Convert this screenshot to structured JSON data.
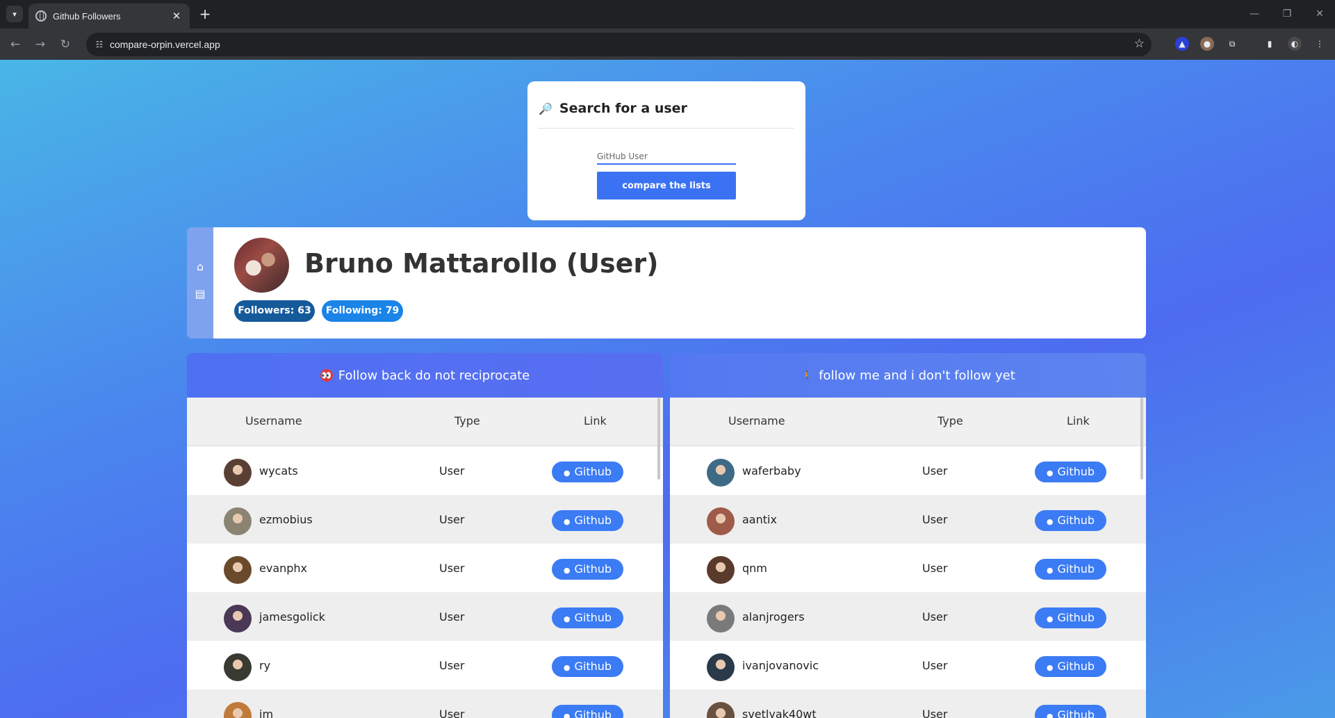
{
  "browser": {
    "tab_title": "Github Followers",
    "url": "compare-orpin.vercel.app"
  },
  "search": {
    "title": "Search for a user",
    "placeholder": "GitHub User",
    "button_label": "compare the lists"
  },
  "profile": {
    "name": "Bruno Mattarollo (User)",
    "followers_label": "Followers: 63",
    "following_label": "Following: 79"
  },
  "columns": {
    "username": "Username",
    "type": "Type",
    "link": "Link"
  },
  "left_panel": {
    "title": "Follow back do not reciprocate",
    "rows": [
      {
        "username": "wycats",
        "type": "User",
        "link": "Github",
        "avatar_color": "#5a4034"
      },
      {
        "username": "ezmobius",
        "type": "User",
        "link": "Github",
        "avatar_color": "#8b8472"
      },
      {
        "username": "evanphx",
        "type": "User",
        "link": "Github",
        "avatar_color": "#6a4a2a"
      },
      {
        "username": "jamesgolick",
        "type": "User",
        "link": "Github",
        "avatar_color": "#4a3856"
      },
      {
        "username": "ry",
        "type": "User",
        "link": "Github",
        "avatar_color": "#3a3a32"
      },
      {
        "username": "jm",
        "type": "User",
        "link": "Github",
        "avatar_color": "#c07a3a"
      }
    ]
  },
  "right_panel": {
    "title": "follow me and i don't follow yet",
    "rows": [
      {
        "username": "waferbaby",
        "type": "User",
        "link": "Github",
        "avatar_color": "#3f6a86"
      },
      {
        "username": "aantix",
        "type": "User",
        "link": "Github",
        "avatar_color": "#a05a4a"
      },
      {
        "username": "qnm",
        "type": "User",
        "link": "Github",
        "avatar_color": "#5a3a2a"
      },
      {
        "username": "alanjrogers",
        "type": "User",
        "link": "Github",
        "avatar_color": "#7a7a7a"
      },
      {
        "username": "ivanjovanovic",
        "type": "User",
        "link": "Github",
        "avatar_color": "#2a3a4a"
      },
      {
        "username": "svetlyak40wt",
        "type": "User",
        "link": "Github",
        "avatar_color": "#6a5040"
      }
    ]
  }
}
